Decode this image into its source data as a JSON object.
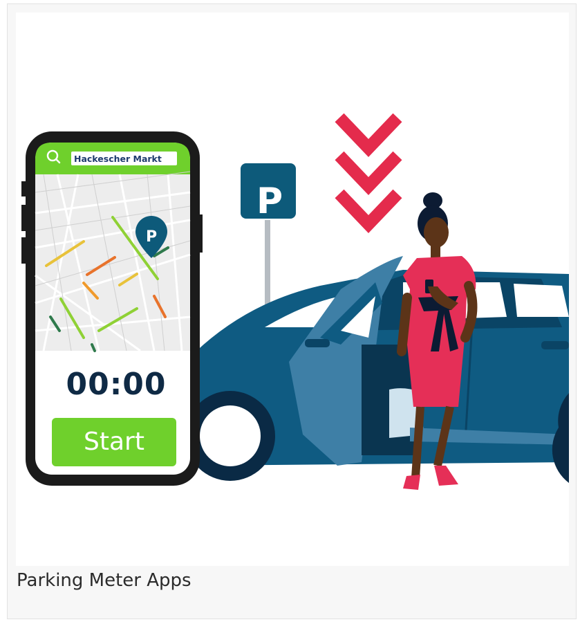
{
  "card": {
    "caption": "Parking Meter Apps"
  },
  "phone": {
    "search_text": "Hackescher Markt",
    "timer": "00:00",
    "start_label": "Start",
    "map_pin_letter": "P"
  },
  "parking_sign": {
    "letter": "P"
  },
  "colors": {
    "brand_green": "#6fd02c",
    "sign_blue": "#0d5a7a",
    "car_blue": "#0f5b82",
    "chevron_red": "#e42b4c",
    "dress_red": "#e52f57",
    "phone_frame": "#1b1b1b"
  }
}
